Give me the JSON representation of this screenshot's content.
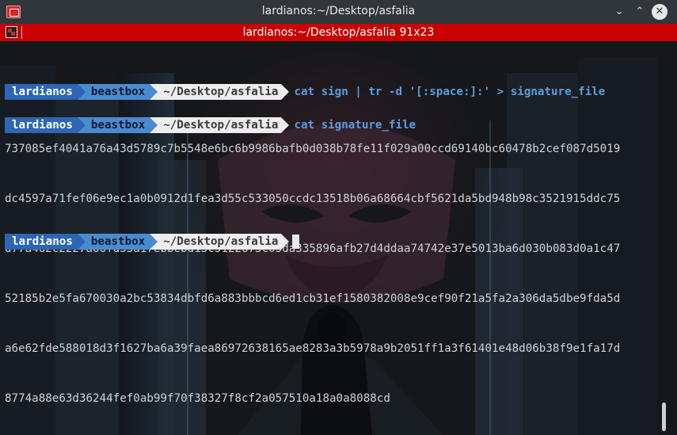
{
  "window": {
    "title": "lardianos:~/Desktop/asfalia",
    "app_icon": "konsole-icon",
    "controls": [
      "minimize-icon",
      "maximize-icon",
      "close-icon"
    ],
    "minimize_glyph": "⌄",
    "maximize_glyph": "⌃",
    "close_glyph": "✕"
  },
  "tab": {
    "title": "lardianos:~/Desktop/asfalia 91x23",
    "icon": "split-view-icon",
    "accent_color": "#c90000"
  },
  "prompt": {
    "user": "lardianos",
    "host": "beastbox",
    "path": "~/Desktop/asfalia"
  },
  "commands": [
    "cat sign | tr -d '[:space:]:' > signature_file",
    "cat signature_file"
  ],
  "output_lines": [
    "737085ef4041a76a43d5789c7b5548e6bc6b9986bafb0d038b78fe11f029a00ccd69140bc60478b2cef087d5019",
    "dc4597a71fef06e9ec1a0b0912d1fea3d55c533050ccdc13518b06a68664cbf5621da5bd948b98c3521915ddc75",
    "d77a462c2227a66fd33a17ebbebd13c5122673c05da335896afb27d4ddaa74742e37e5013ba6d030b083d0a1c47",
    "52185b2e5fa670030a2bc53834dbfd6a883bbbcd6ed1cb31ef1580382008e9cef90f21a5fa2a306da5dbe9fda5d",
    "a6e62fde588018d3f1627ba6a39faea86972638165ae8283a3b5978a9b2051ff1a3f61401e48d06b38f9e1fa17d",
    "8774a88e63d36244fef0ab99f70f38327f8cf2a057510a18a0a8088cd"
  ],
  "colors": {
    "user_segment": "#2c66b4",
    "host_segment": "#4a8bd0",
    "path_segment": "#ededed",
    "command_text": "#5b9ddf",
    "titlebar": "#31363b"
  }
}
